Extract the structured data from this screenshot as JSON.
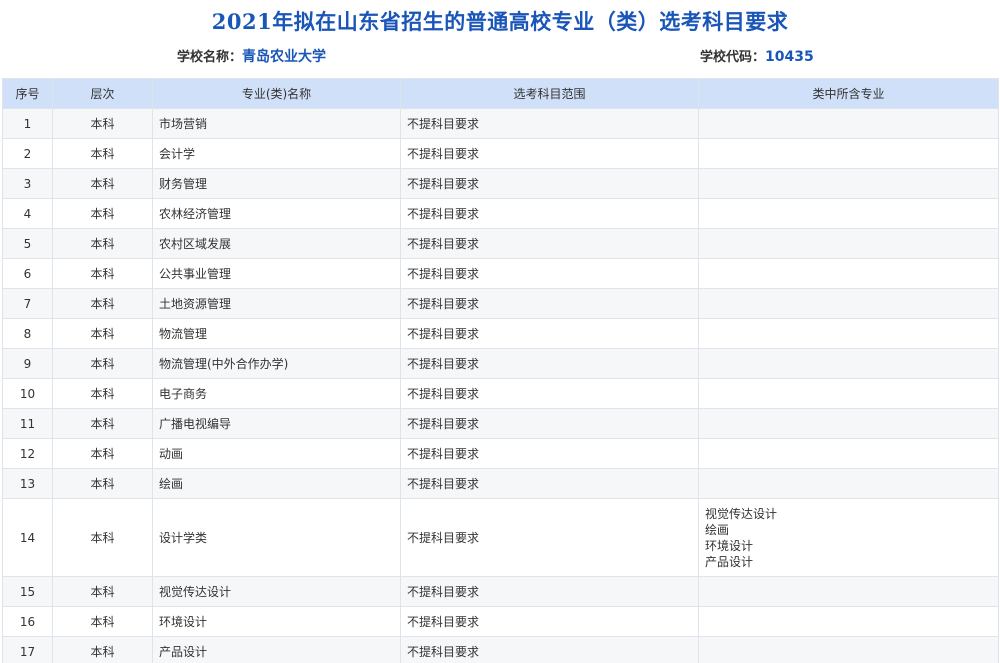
{
  "title": "2021年拟在山东省招生的普通高校专业（类）选考科目要求",
  "school_name_label": "学校名称：",
  "school_name": "青岛农业大学",
  "school_code_label": "学校代码：",
  "school_code": "10435",
  "columns": [
    "序号",
    "层次",
    "专业(类)名称",
    "选考科目范围",
    "类中所含专业"
  ],
  "rows": [
    {
      "no": "1",
      "level": "本科",
      "major": "市场营销",
      "req": "不提科目要求",
      "sub": []
    },
    {
      "no": "2",
      "level": "本科",
      "major": "会计学",
      "req": "不提科目要求",
      "sub": []
    },
    {
      "no": "3",
      "level": "本科",
      "major": "财务管理",
      "req": "不提科目要求",
      "sub": []
    },
    {
      "no": "4",
      "level": "本科",
      "major": "农林经济管理",
      "req": "不提科目要求",
      "sub": []
    },
    {
      "no": "5",
      "level": "本科",
      "major": "农村区域发展",
      "req": "不提科目要求",
      "sub": []
    },
    {
      "no": "6",
      "level": "本科",
      "major": "公共事业管理",
      "req": "不提科目要求",
      "sub": []
    },
    {
      "no": "7",
      "level": "本科",
      "major": "土地资源管理",
      "req": "不提科目要求",
      "sub": []
    },
    {
      "no": "8",
      "level": "本科",
      "major": "物流管理",
      "req": "不提科目要求",
      "sub": []
    },
    {
      "no": "9",
      "level": "本科",
      "major": "物流管理(中外合作办学)",
      "req": "不提科目要求",
      "sub": []
    },
    {
      "no": "10",
      "level": "本科",
      "major": "电子商务",
      "req": "不提科目要求",
      "sub": []
    },
    {
      "no": "11",
      "level": "本科",
      "major": "广播电视编导",
      "req": "不提科目要求",
      "sub": []
    },
    {
      "no": "12",
      "level": "本科",
      "major": "动画",
      "req": "不提科目要求",
      "sub": []
    },
    {
      "no": "13",
      "level": "本科",
      "major": "绘画",
      "req": "不提科目要求",
      "sub": []
    },
    {
      "no": "14",
      "level": "本科",
      "major": "设计学类",
      "req": "不提科目要求",
      "sub": [
        "视觉传达设计",
        "绘画",
        "环境设计",
        "产品设计"
      ]
    },
    {
      "no": "15",
      "level": "本科",
      "major": "视觉传达设计",
      "req": "不提科目要求",
      "sub": []
    },
    {
      "no": "16",
      "level": "本科",
      "major": "环境设计",
      "req": "不提科目要求",
      "sub": []
    },
    {
      "no": "17",
      "level": "本科",
      "major": "产品设计",
      "req": "不提科目要求",
      "sub": []
    }
  ],
  "colors": {
    "accent": "#1a56b8",
    "header_bg": "#cfe0f8",
    "row_alt": "#f6f7f9"
  }
}
